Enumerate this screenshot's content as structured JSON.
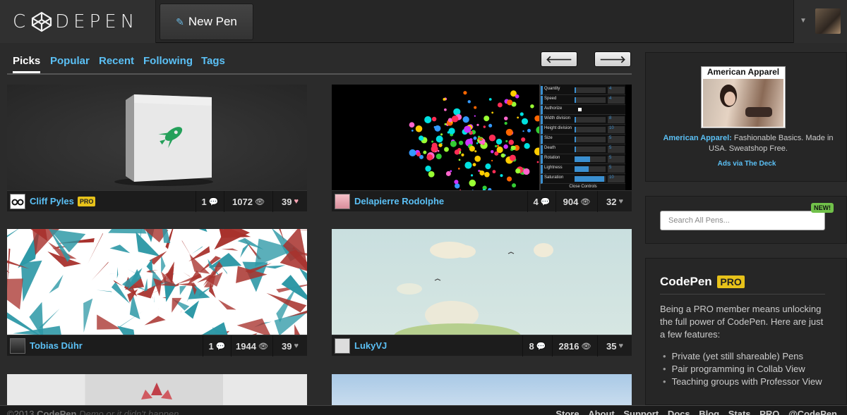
{
  "header": {
    "logo_left": "C",
    "logo_right": "DEPEN",
    "new_pen_label": "New Pen"
  },
  "tabs": [
    {
      "label": "Picks",
      "active": true
    },
    {
      "label": "Popular"
    },
    {
      "label": "Recent"
    },
    {
      "label": "Following"
    },
    {
      "label": "Tags"
    }
  ],
  "nav": {
    "prev_icon": "arrow-left-icon",
    "next_icon": "arrow-right-icon",
    "prev": "🡐",
    "next": "🡒"
  },
  "pens": [
    {
      "author": "Cliff Pyles",
      "pro": "PRO",
      "comments": "1",
      "views": "1072",
      "likes": "39"
    },
    {
      "author": "Delapierre Rodolphe",
      "comments": "4",
      "views": "904",
      "likes": "32"
    },
    {
      "author": "Tobias Dühr",
      "comments": "1",
      "views": "1944",
      "likes": "39"
    },
    {
      "author": "LukyVJ",
      "comments": "8",
      "views": "2816",
      "likes": "35"
    }
  ],
  "controls_panel": {
    "rows": [
      "Quantity",
      "Speed",
      "Authorize",
      "Width division",
      "Height division",
      "Size",
      "Death",
      "Rotation",
      "Lightness",
      "Saturation"
    ],
    "values": [
      "4",
      "4",
      "",
      "8",
      "10",
      "5",
      "5",
      "5",
      "5",
      "10"
    ],
    "close": "Close Controls"
  },
  "ad": {
    "brand_image_text": "American Apparel",
    "link": "American Apparel:",
    "text": "Fashionable Basics. Made in USA. Sweatshop Free.",
    "via": "Ads via The Deck"
  },
  "search": {
    "placeholder": "Search All Pens...",
    "badge": "NEW!"
  },
  "pro_box": {
    "title": "CodePen",
    "badge": "PRO",
    "intro": "Being a PRO member means unlocking the full power of CodePen. Here are just a few features:",
    "features": [
      "Private (yet still shareable) Pens",
      "Pair programming in Collab View",
      "Teaching groups with Professor View"
    ]
  },
  "footer": {
    "copyright": "©2013",
    "brand": "CodePen",
    "tagline": "Demo or it didn't happen.",
    "links": [
      "Store",
      "About",
      "Support",
      "Docs",
      "Blog",
      "Stats",
      "PRO",
      "@CodePen"
    ]
  },
  "colors": {
    "link": "#5bc0f5",
    "pro": "#e7c21a",
    "new": "#71c14a"
  }
}
